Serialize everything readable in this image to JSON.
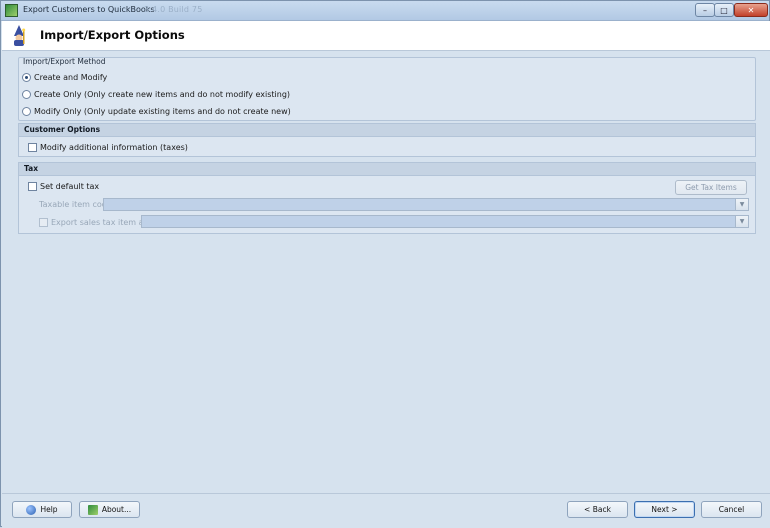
{
  "window": {
    "title": "Export Customers to QuickBooks",
    "title_ghost": "3.4.0 Build 75",
    "minimize": "–",
    "maximize": "□",
    "close": "✕"
  },
  "header": {
    "title": "Import/Export Options"
  },
  "import_export_method": {
    "label": "Import/Export Method",
    "options": [
      {
        "label": "Create and Modify",
        "selected": true
      },
      {
        "label": "Create Only (Only create new items and do not modify existing)",
        "selected": false
      },
      {
        "label": "Modify Only (Only update existing items and do not create new)",
        "selected": false
      }
    ]
  },
  "customer_options": {
    "title": "Customer Options",
    "modify_additional": {
      "label": "Modify additional information (taxes)",
      "checked": false
    }
  },
  "tax": {
    "title": "Tax",
    "set_default_tax": {
      "label": "Set default tax",
      "checked": false
    },
    "get_tax_items_label": "Get Tax Items",
    "taxable_item_code_label": "Taxable item code",
    "taxable_item_code_value": "",
    "export_sales_tax_item_as": {
      "label": "Export sales tax item as",
      "checked": false
    },
    "export_sales_tax_value": ""
  },
  "footer": {
    "help_label": "Help",
    "about_label": "About...",
    "back_label": "< Back",
    "next_label": "Next >",
    "cancel_label": "Cancel"
  },
  "colors": {
    "accent": "#3b6fb0",
    "panel": "#d6e2ee",
    "section_header": "#c5d3e3"
  }
}
